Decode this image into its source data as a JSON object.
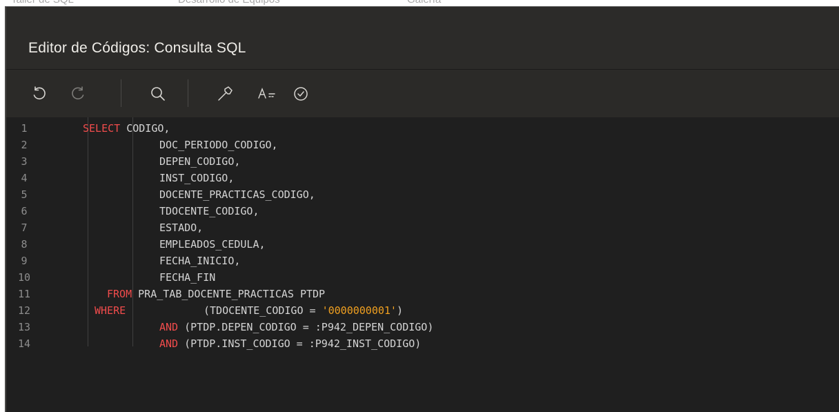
{
  "background_tabs": [
    "Taller de SQL",
    "Desarrollo de Equipos",
    "Galería"
  ],
  "dialog": {
    "title": "Editor de Códigos: Consulta SQL"
  },
  "toolbar": {
    "buttons": [
      {
        "name": "undo",
        "icon": "undo-icon"
      },
      {
        "name": "redo",
        "icon": "redo-icon"
      },
      {
        "name": "search",
        "icon": "search-icon"
      },
      {
        "name": "hammer",
        "icon": "hammer-icon"
      },
      {
        "name": "autocomplete",
        "icon": "autocomplete-icon",
        "label": "A="
      },
      {
        "name": "validate",
        "icon": "check-circle-icon"
      }
    ]
  },
  "editor": {
    "colors": {
      "keyword": "#f14c4c",
      "string": "#f0a020",
      "text": "#d4d4d4",
      "line_number": "#8d8d8d",
      "background": "#1f1f1f"
    },
    "lines": [
      {
        "num": "1",
        "kw": "SELECT",
        "code": " CODIGO,"
      },
      {
        "num": "2",
        "kw": "",
        "code": "DOC_PERIODO_CODIGO,"
      },
      {
        "num": "3",
        "kw": "",
        "code": "DEPEN_CODIGO,"
      },
      {
        "num": "4",
        "kw": "",
        "code": "INST_CODIGO,"
      },
      {
        "num": "5",
        "kw": "",
        "code": "DOCENTE_PRACTICAS_CODIGO,"
      },
      {
        "num": "6",
        "kw": "",
        "code": "TDOCENTE_CODIGO,"
      },
      {
        "num": "7",
        "kw": "",
        "code": "ESTADO,"
      },
      {
        "num": "8",
        "kw": "",
        "code": "EMPLEADOS_CEDULA,"
      },
      {
        "num": "9",
        "kw": "",
        "code": "FECHA_INICIO,"
      },
      {
        "num": "10",
        "kw": "",
        "code": "FECHA_FIN"
      },
      {
        "num": "11",
        "kw": "FROM",
        "code": " PRA_TAB_DOCENTE_PRACTICAS PTDP"
      },
      {
        "num": "12",
        "kw": "WHERE",
        "code": "(TDOCENTE_CODIGO = ",
        "str": "'0000000001'",
        "tail": ")"
      },
      {
        "num": "13",
        "kw": "AND",
        "code": " (PTDP.DEPEN_CODIGO = :P942_DEPEN_CODIGO)"
      },
      {
        "num": "14",
        "kw": "AND",
        "code": " (PTDP.INST_CODIGO = :P942_INST_CODIGO)"
      }
    ]
  }
}
